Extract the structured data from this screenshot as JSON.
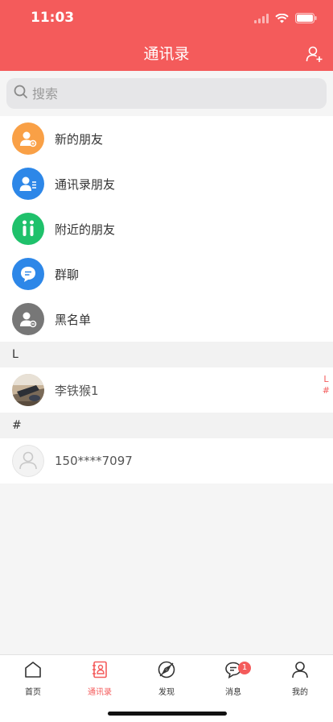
{
  "status_bar": {
    "time": "11:03"
  },
  "header": {
    "title": "通讯录"
  },
  "search": {
    "placeholder": "搜索"
  },
  "menu_items": [
    {
      "label": "新的朋友",
      "icon": "add-friend-icon",
      "color": "#f9a046"
    },
    {
      "label": "通讯录朋友",
      "icon": "contact-list-icon",
      "color": "#2d87e8"
    },
    {
      "label": "附近的朋友",
      "icon": "nearby-people-icon",
      "color": "#1fc16b"
    },
    {
      "label": "群聊",
      "icon": "group-chat-icon",
      "color": "#2d87e8"
    },
    {
      "label": "黑名单",
      "icon": "blacklist-icon",
      "color": "#777777"
    }
  ],
  "sections": [
    {
      "letter": "L",
      "contacts": [
        {
          "name": "李铁猴1"
        }
      ]
    },
    {
      "letter": "#",
      "contacts": [
        {
          "name": "150****7097"
        }
      ]
    }
  ],
  "index_bar": [
    "L",
    "#"
  ],
  "tabs": [
    {
      "label": "首页",
      "icon": "home-icon"
    },
    {
      "label": "通讯录",
      "icon": "contacts-icon",
      "active": true
    },
    {
      "label": "发现",
      "icon": "discover-icon"
    },
    {
      "label": "消息",
      "icon": "message-icon",
      "badge": "1"
    },
    {
      "label": "我的",
      "icon": "profile-icon"
    }
  ],
  "colors": {
    "accent": "#f45b5b",
    "background": "#f5f5f5"
  }
}
